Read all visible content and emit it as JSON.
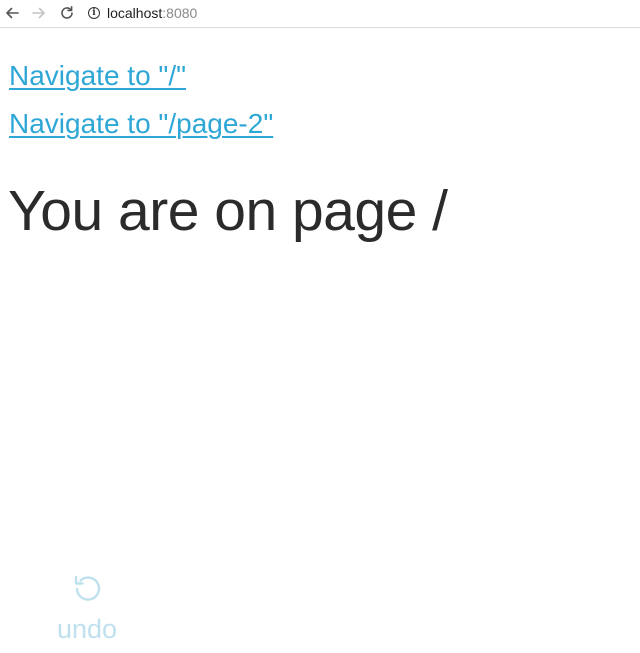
{
  "browser": {
    "url_host": "localhost",
    "url_port": ":8080",
    "info_glyph": "i"
  },
  "links": [
    {
      "label": "Navigate to \"/\""
    },
    {
      "label": "Navigate to \"/page-2\""
    }
  ],
  "heading": "You are on page /",
  "undo": {
    "label": "undo",
    "icon": "undo-icon"
  },
  "colors": {
    "link": "#2ea7d6",
    "heading": "#2b2b2b",
    "undo": "#bfe0ee"
  }
}
